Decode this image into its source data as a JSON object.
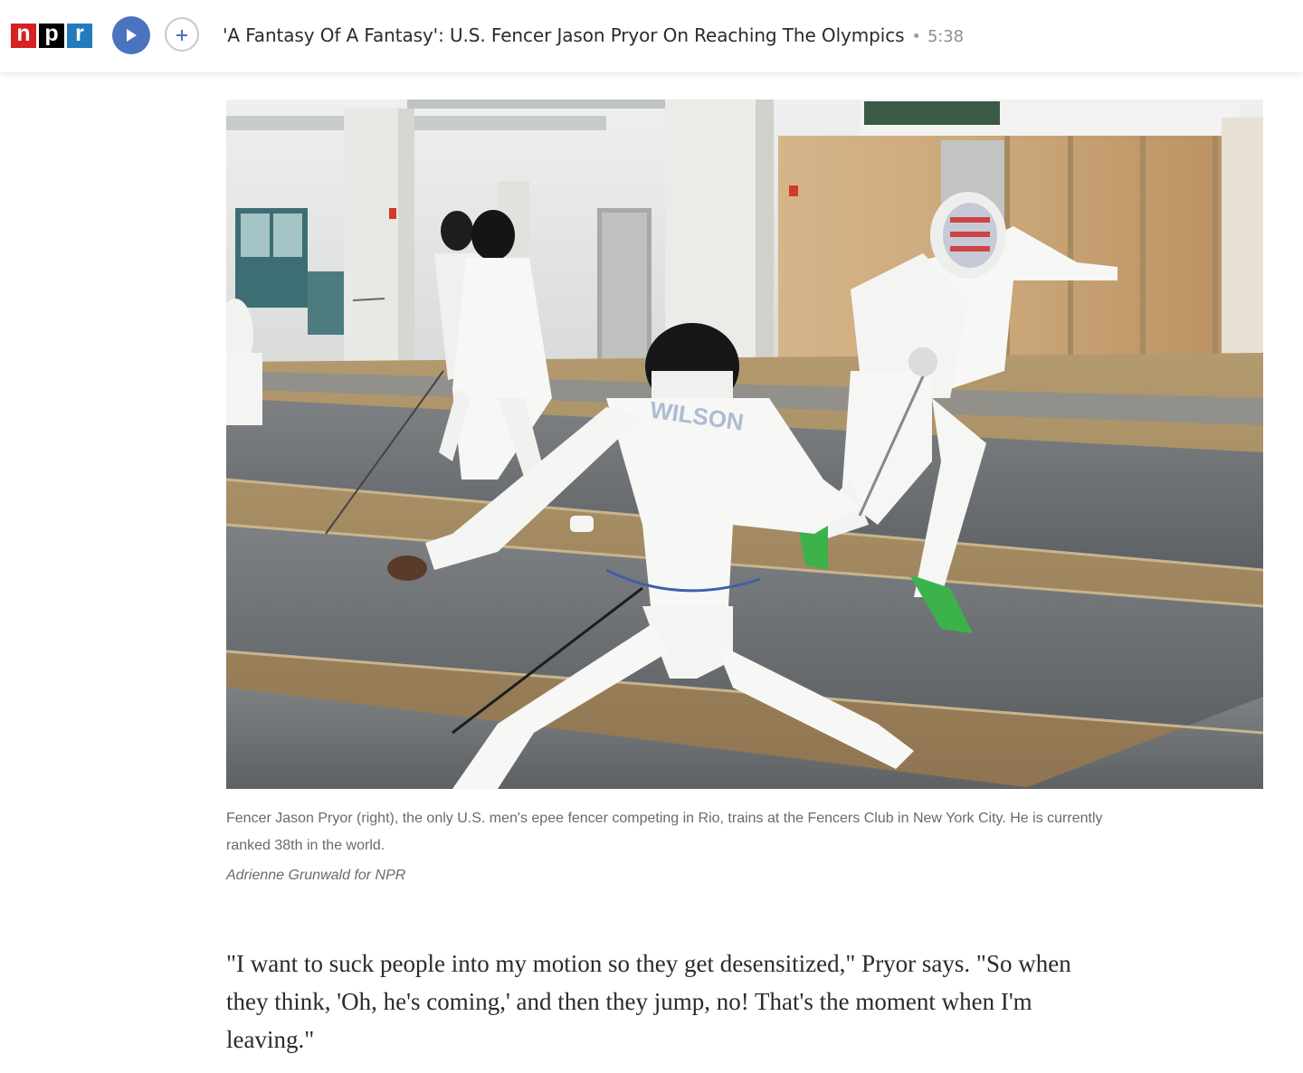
{
  "player": {
    "logo_letters": [
      "n",
      "p",
      "r"
    ],
    "title": "'A Fantasy Of A Fantasy': U.S. Fencer Jason Pryor On Reaching The Olympics",
    "separator": "•",
    "duration": "5:38",
    "play_icon": "play-icon",
    "add_icon": "plus-icon",
    "colors": {
      "play": "#4a73c0",
      "logo_n": "#d62021",
      "logo_p": "#000000",
      "logo_r": "#237bbd"
    }
  },
  "photo": {
    "jersey_name": "WILSON"
  },
  "caption": {
    "text": "Fencer Jason Pryor (right), the only U.S. men's epee fencer competing in Rio, trains at the Fencers Club in New York City. He is currently ranked 38th in the world.",
    "credit": "Adrienne Grunwald for NPR"
  },
  "article": {
    "paragraph": "\"I want to suck people into my motion so they get desensitized,\" Pryor says. \"So when they think, 'Oh, he's coming,' and then they jump, no! That's the moment when I'm leaving.\""
  }
}
